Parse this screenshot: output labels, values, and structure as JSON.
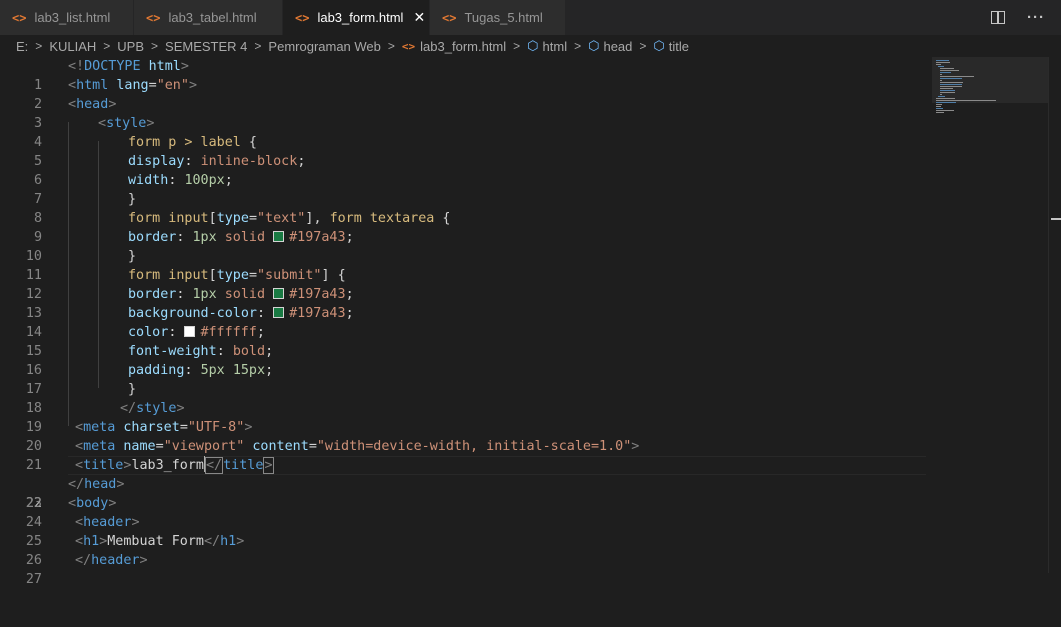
{
  "tabs": [
    {
      "label": "lab3_list.html",
      "icon": "<>",
      "active": false
    },
    {
      "label": "lab3_tabel.html",
      "icon": "<>",
      "active": false
    },
    {
      "label": "lab3_form.html",
      "icon": "<>",
      "active": true,
      "close": "✕"
    },
    {
      "label": "Tugas_5.html",
      "icon": "<>",
      "active": false
    }
  ],
  "tab_actions": {
    "more": "···"
  },
  "breadcrumb": {
    "items": [
      "E:",
      "KULIAH",
      "UPB",
      "SEMESTER 4",
      "Pemrograman Web"
    ],
    "file": "lab3_form.html",
    "symbols": [
      "html",
      "head",
      "title"
    ],
    "separator": ">"
  },
  "swatch_colors": {
    "green": "#197a43",
    "white": "#ffffff"
  },
  "editor": {
    "current_line": 22,
    "lines": [
      {
        "n": "1",
        "indent": 0
      },
      {
        "n": "2",
        "indent": 0
      },
      {
        "n": "3",
        "indent": 0
      },
      {
        "n": "4",
        "indent": 1
      },
      {
        "n": "5",
        "indent": 2
      },
      {
        "n": "6",
        "indent": 2
      },
      {
        "n": "7",
        "indent": 2
      },
      {
        "n": "8",
        "indent": 2
      },
      {
        "n": "9",
        "indent": 2
      },
      {
        "n": "10",
        "indent": 2
      },
      {
        "n": "11",
        "indent": 2
      },
      {
        "n": "12",
        "indent": 2
      },
      {
        "n": "13",
        "indent": 2
      },
      {
        "n": "14",
        "indent": 2
      },
      {
        "n": "15",
        "indent": 2
      },
      {
        "n": "16",
        "indent": 2
      },
      {
        "n": "17",
        "indent": 2
      },
      {
        "n": "18",
        "indent": 2
      },
      {
        "n": "19",
        "indent": 1
      },
      {
        "n": "20",
        "indent": 0
      },
      {
        "n": "21",
        "indent": 0
      },
      {
        "n": "22",
        "indent": 0
      },
      {
        "n": "23",
        "indent": 0
      },
      {
        "n": "24",
        "indent": 0
      },
      {
        "n": "25",
        "indent": 0
      },
      {
        "n": "26",
        "indent": 0
      },
      {
        "n": "27",
        "indent": 0
      }
    ],
    "code": {
      "l1": [
        "<!",
        "DOCTYPE",
        " html",
        ">"
      ],
      "l2": [
        "<",
        "html",
        " lang",
        "=",
        "\"en\"",
        ">"
      ],
      "l3": [
        "<",
        "head",
        ">"
      ],
      "l4": [
        "<",
        "style",
        ">"
      ],
      "l5": [
        "form p > label",
        " {"
      ],
      "l6": [
        "display",
        ": ",
        "inline-block",
        ";"
      ],
      "l7": [
        "width",
        ": ",
        "100px",
        ";"
      ],
      "l8": [
        "}"
      ],
      "l9": [
        "form input",
        "[",
        "type",
        "=",
        "\"text\"",
        "]",
        ", ",
        "form textarea",
        " {"
      ],
      "l10": [
        "border",
        ": ",
        "1px",
        " ",
        "solid",
        " ",
        "#197a43",
        ";"
      ],
      "l11": [
        "}"
      ],
      "l12": [
        "form input",
        "[",
        "type",
        "=",
        "\"submit\"",
        "]",
        " {"
      ],
      "l13": [
        "border",
        ": ",
        "1px",
        " ",
        "solid",
        " ",
        "#197a43",
        ";"
      ],
      "l14": [
        "background-color",
        ": ",
        "#197a43",
        ";"
      ],
      "l15": [
        "color",
        ": ",
        "#ffffff",
        ";"
      ],
      "l16": [
        "font-weight",
        ": ",
        "bold",
        ";"
      ],
      "l17": [
        "padding",
        ": ",
        "5px",
        " ",
        "15px",
        ";"
      ],
      "l18": [
        "}"
      ],
      "l19": [
        "</",
        "style",
        ">"
      ],
      "l20": [
        "<",
        "meta",
        " charset",
        "=",
        "\"UTF-8\"",
        ">"
      ],
      "l21": [
        "<",
        "meta",
        " name",
        "=",
        "\"viewport\"",
        " content",
        "=",
        "\"width=device-width, initial-scale=1.0\"",
        ">"
      ],
      "l22": [
        "<",
        "title",
        ">",
        "lab3_form",
        "</",
        "title",
        ">"
      ],
      "l23": [
        "</",
        "head",
        ">"
      ],
      "l24": [
        "<",
        "body",
        ">"
      ],
      "l25": [
        "<",
        "header",
        ">"
      ],
      "l26": [
        "<",
        "h1",
        ">",
        "Membuat Form",
        "</",
        "h1",
        ">"
      ],
      "l27": [
        "</",
        "header",
        ">"
      ]
    }
  }
}
